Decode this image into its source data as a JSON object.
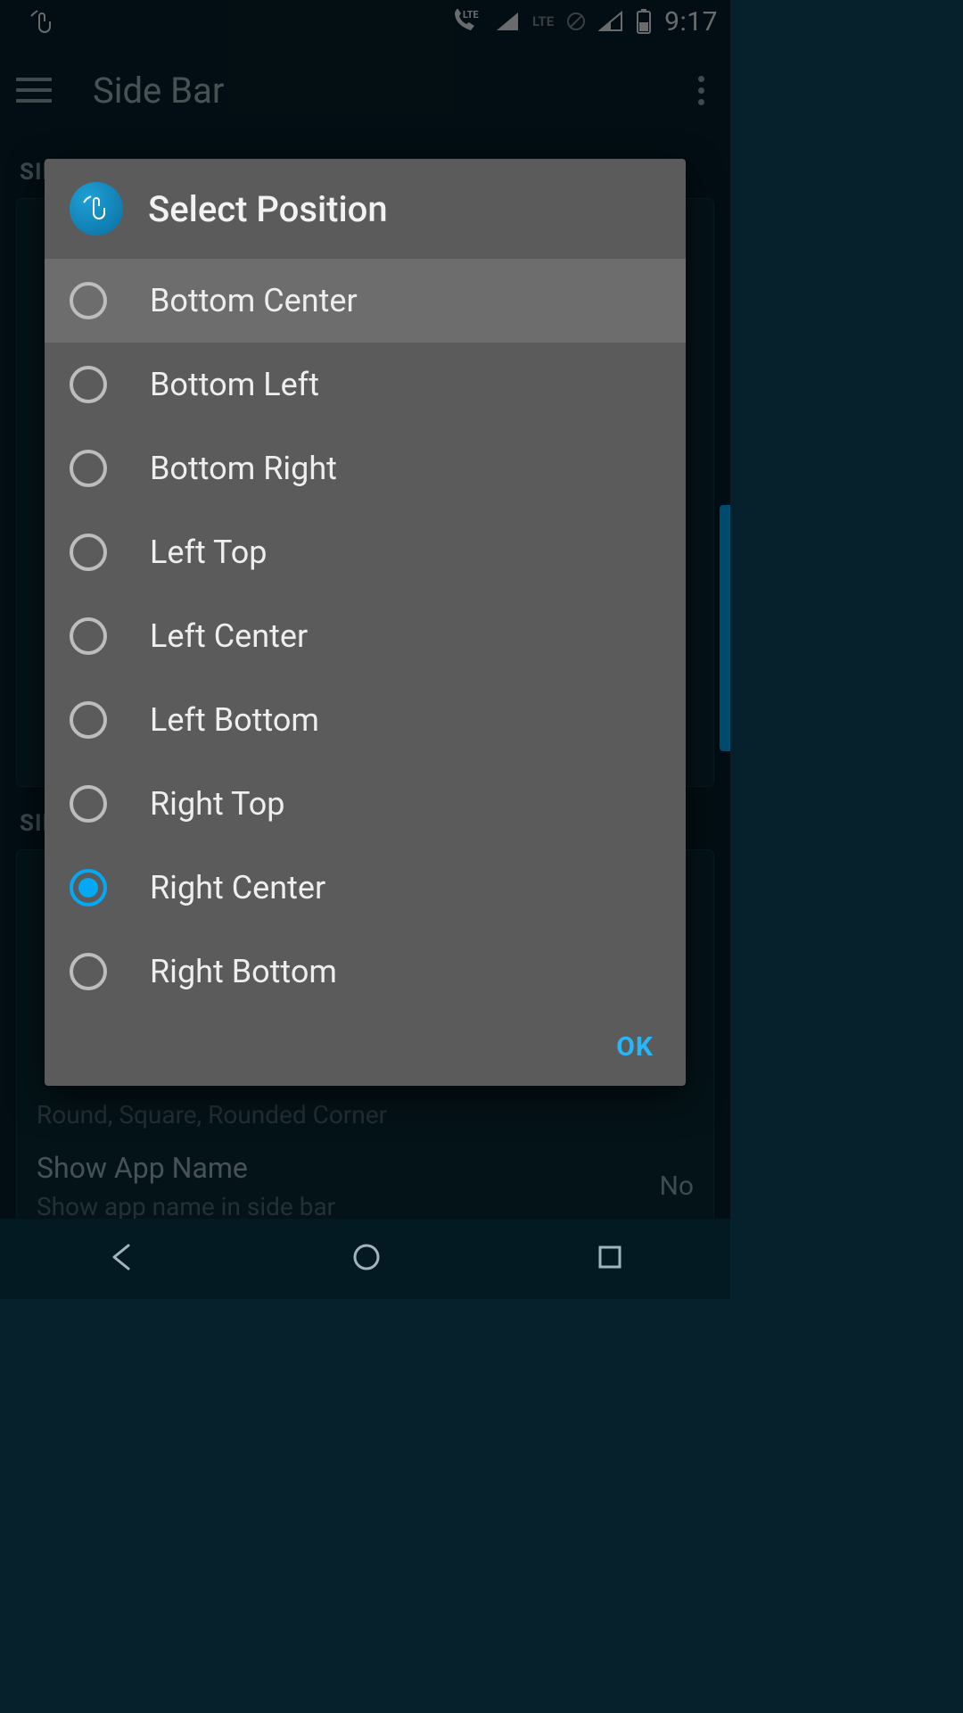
{
  "status_bar": {
    "clock": "9:17",
    "lte1": "LTE",
    "lte2": "LTE"
  },
  "app_bar": {
    "title": "Side Bar"
  },
  "bg": {
    "section1": "SIDEBAR SETTING",
    "section2": "SID",
    "icon_shape_sub": "Round, Square, Rounded Corner",
    "show_app_title": "Show App Name",
    "show_app_sub": "Show app name in side bar",
    "no_label": "No"
  },
  "dialog": {
    "title": "Select Position",
    "ok_label": "OK",
    "options": [
      {
        "label": "Bottom Center",
        "checked": false,
        "highlight": true
      },
      {
        "label": "Bottom Left",
        "checked": false,
        "highlight": false
      },
      {
        "label": "Bottom Right",
        "checked": false,
        "highlight": false
      },
      {
        "label": "Left Top",
        "checked": false,
        "highlight": false
      },
      {
        "label": "Left Center",
        "checked": false,
        "highlight": false
      },
      {
        "label": "Left Bottom",
        "checked": false,
        "highlight": false
      },
      {
        "label": "Right Top",
        "checked": false,
        "highlight": false
      },
      {
        "label": "Right Center",
        "checked": true,
        "highlight": false
      },
      {
        "label": "Right Bottom",
        "checked": false,
        "highlight": false
      }
    ]
  }
}
